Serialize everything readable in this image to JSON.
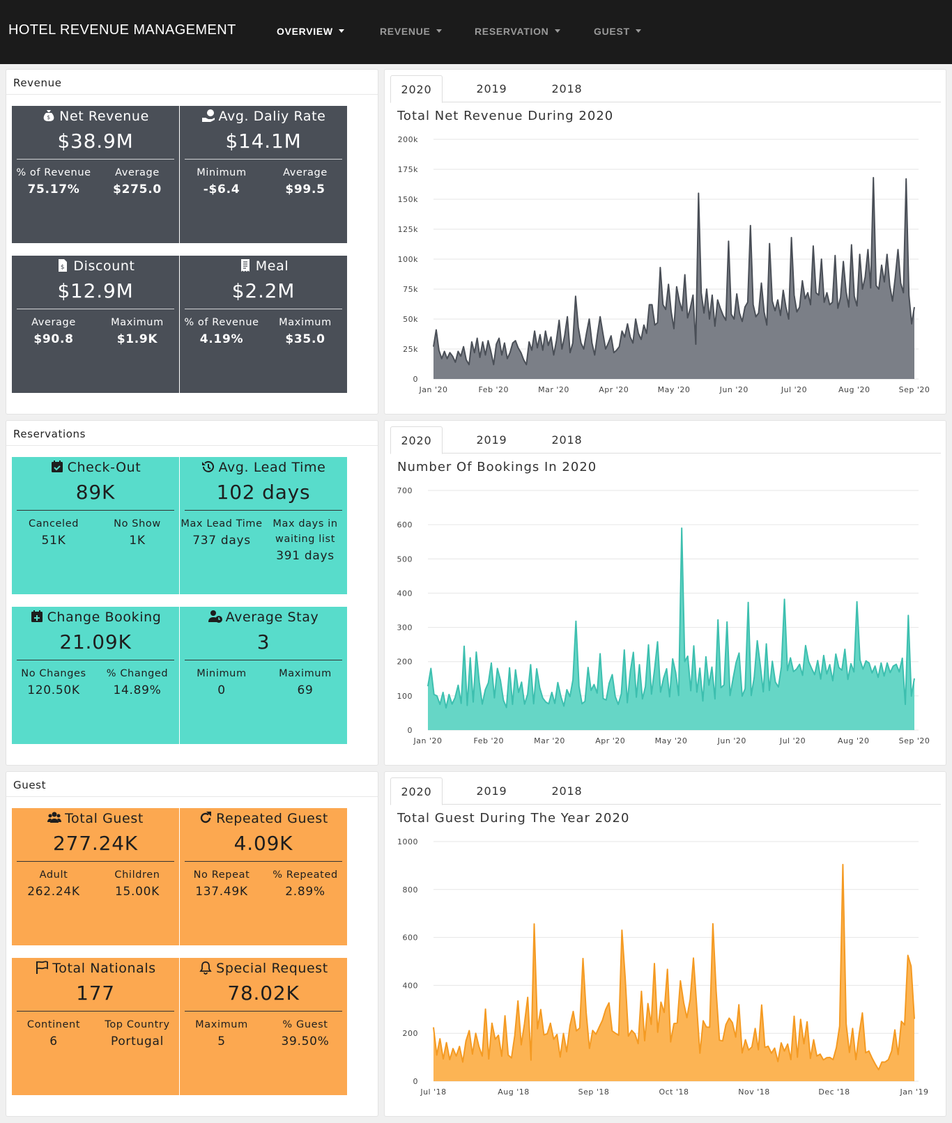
{
  "nav": {
    "brand": "HOTEL REVENUE MANAGEMENT",
    "items": [
      {
        "label": "OVERVIEW",
        "active": true
      },
      {
        "label": "REVENUE",
        "active": false
      },
      {
        "label": "RESERVATION",
        "active": false
      },
      {
        "label": "GUEST",
        "active": false
      }
    ]
  },
  "sections": {
    "revenue": {
      "title": "Revenue",
      "cards": [
        {
          "icon": "money-bag-icon",
          "title": "Net Revenue",
          "value": "$38.9M",
          "stats": [
            {
              "label": "% of Revenue",
              "value": "75.17%"
            },
            {
              "label": "Average",
              "value": "$275.0"
            }
          ]
        },
        {
          "icon": "hand-money-icon",
          "title": "Avg. Daliy Rate",
          "value": "$14.1M",
          "stats": [
            {
              "label": "Minimum",
              "value": "-$6.4"
            },
            {
              "label": "Average",
              "value": "$99.5"
            }
          ]
        },
        {
          "icon": "receipt-dollar-icon",
          "title": "Discount",
          "value": "$12.9M",
          "stats": [
            {
              "label": "Average",
              "value": "$90.8"
            },
            {
              "label": "Maximum",
              "value": "$1.9K"
            }
          ]
        },
        {
          "icon": "menu-receipt-icon",
          "title": "Meal",
          "value": "$2.2M",
          "stats": [
            {
              "label": "% of Revenue",
              "value": "4.19%"
            },
            {
              "label": "Maximum",
              "value": "$35.0"
            }
          ]
        }
      ]
    },
    "reservations": {
      "title": "Reservations",
      "cards": [
        {
          "icon": "calendar-check-icon",
          "title": "Check-Out",
          "value": "89K",
          "stats": [
            {
              "label": "Canceled",
              "value": "51K"
            },
            {
              "label": "No Show",
              "value": "1K"
            }
          ]
        },
        {
          "icon": "history-icon",
          "title": "Avg. Lead Time",
          "value": "102 days",
          "stats": [
            {
              "label": "Max Lead Time",
              "value": "737 days"
            },
            {
              "label": "Max days in waiting list",
              "value": "391 days"
            }
          ]
        },
        {
          "icon": "calendar-plus-icon",
          "title": "Change Booking",
          "value": "21.09K",
          "stats": [
            {
              "label": "No Changes",
              "value": "120.50K"
            },
            {
              "label": "% Changed",
              "value": "14.89%"
            }
          ]
        },
        {
          "icon": "user-clock-icon",
          "title": "Average Stay",
          "value": "3",
          "stats": [
            {
              "label": "Minimum",
              "value": "0"
            },
            {
              "label": "Maximum",
              "value": "69"
            }
          ]
        }
      ]
    },
    "guest": {
      "title": "Guest",
      "cards": [
        {
          "icon": "users-icon",
          "title": "Total Guest",
          "value": "277.24K",
          "stats": [
            {
              "label": "Adult",
              "value": "262.24K"
            },
            {
              "label": "Children",
              "value": "15.00K"
            }
          ]
        },
        {
          "icon": "redo-icon",
          "title": "Repeated Guest",
          "value": "4.09K",
          "stats": [
            {
              "label": "No Repeat",
              "value": "137.49K"
            },
            {
              "label": "% Repeated",
              "value": "2.89%"
            }
          ]
        },
        {
          "icon": "flag-icon",
          "title": "Total Nationals",
          "value": "177",
          "stats": [
            {
              "label": "Continent",
              "value": "6"
            },
            {
              "label": "Top Country",
              "value": "Portugal"
            }
          ]
        },
        {
          "icon": "bell-icon",
          "title": "Special Request",
          "value": "78.02K",
          "stats": [
            {
              "label": "Maximum",
              "value": "5"
            },
            {
              "label": "% Guest",
              "value": "39.50%"
            }
          ]
        }
      ]
    }
  },
  "tabs": [
    "2020",
    "2019",
    "2018"
  ],
  "colors": {
    "revenue": "#4a4f57",
    "revenue_fill": "#7b7f87",
    "bookings": "#3dbfaf",
    "bookings_fill": "#66d6c6",
    "guest": "#f49a22",
    "guest_fill": "#fcb454"
  },
  "chart_data": [
    {
      "type": "area",
      "title": "Total Net Revenue During 2020",
      "x_range": [
        "2020-01-01",
        "2020-09-05"
      ],
      "x_ticks": [
        "Jan '20",
        "Feb '20",
        "Mar '20",
        "Apr '20",
        "May '20",
        "Jun '20",
        "Jul '20",
        "Aug '20",
        "Sep '20"
      ],
      "y_ticks": [
        "0",
        "25k",
        "50k",
        "75k",
        "100k",
        "125k",
        "150k",
        "175k",
        "200k"
      ],
      "ylim": [
        0,
        200000
      ],
      "series": [
        {
          "values": [
            27000,
            41000,
            24000,
            17000,
            23000,
            17000,
            22000,
            19000,
            14000,
            23000,
            19000,
            27000,
            16000,
            12000,
            31000,
            22000,
            34000,
            18000,
            31000,
            20000,
            32000,
            23000,
            12000,
            29000,
            34000,
            20000,
            30000,
            17000,
            22000,
            30000,
            32000,
            26000,
            22000,
            16000,
            12000,
            31000,
            24000,
            40000,
            26000,
            37000,
            24000,
            40000,
            28000,
            35000,
            20000,
            32000,
            49000,
            25000,
            36000,
            52000,
            22000,
            30000,
            69000,
            43000,
            30000,
            25000,
            38000,
            50000,
            30000,
            20000,
            37000,
            52000,
            38000,
            25000,
            30000,
            36000,
            22000,
            24000,
            27000,
            40000,
            35000,
            46000,
            35000,
            30000,
            50000,
            38000,
            33000,
            45000,
            38000,
            62000,
            62000,
            45000,
            47000,
            93000,
            62000,
            58000,
            79000,
            56000,
            42000,
            77000,
            65000,
            57000,
            87000,
            51000,
            59000,
            70000,
            29000,
            155000,
            72000,
            55000,
            75000,
            50000,
            70000,
            44000,
            66000,
            59000,
            53000,
            49000,
            115000,
            54000,
            50000,
            71000,
            55000,
            48000,
            60000,
            64000,
            128000,
            62000,
            52000,
            55000,
            80000,
            56000,
            45000,
            113000,
            65000,
            57000,
            66000,
            53000,
            74000,
            60000,
            50000,
            118000,
            70000,
            56000,
            60000,
            82000,
            67000,
            72000,
            62000,
            111000,
            72000,
            70000,
            100000,
            64000,
            72000,
            62000,
            64000,
            103000,
            59000,
            68000,
            98000,
            73000,
            60000,
            112000,
            69000,
            61000,
            104000,
            75000,
            85000,
            108000,
            76000,
            168000,
            78000,
            75000,
            95000,
            81000,
            104000,
            78000,
            65000,
            85000,
            108000,
            80000,
            72000,
            167000,
            70000,
            46000,
            60000
          ]
        }
      ]
    },
    {
      "type": "area",
      "title": "Number Of Bookings In 2020",
      "x_range": [
        "2020-01-01",
        "2020-09-05"
      ],
      "x_ticks": [
        "Jan '20",
        "Feb '20",
        "Mar '20",
        "Apr '20",
        "May '20",
        "Jun '20",
        "Jul '20",
        "Aug '20",
        "Sep '20"
      ],
      "y_ticks": [
        "0",
        "100",
        "200",
        "300",
        "400",
        "500",
        "600",
        "700"
      ],
      "ylim": [
        0,
        700
      ],
      "series": [
        {
          "values": [
            128,
            180,
            104,
            100,
            75,
            110,
            65,
            104,
            76,
            95,
            131,
            78,
            245,
            72,
            211,
            82,
            228,
            140,
            76,
            118,
            138,
            196,
            94,
            180,
            146,
            87,
            66,
            182,
            75,
            176,
            110,
            140,
            76,
            105,
            191,
            77,
            179,
            124,
            94,
            82,
            77,
            110,
            78,
            139,
            98,
            70,
            118,
            98,
            147,
            318,
            128,
            77,
            84,
            183,
            116,
            133,
            108,
            223,
            92,
            88,
            137,
            162,
            98,
            75,
            106,
            234,
            80,
            172,
            227,
            96,
            191,
            91,
            127,
            249,
            105,
            177,
            258,
            111,
            152,
            179,
            97,
            208,
            168,
            101,
            590,
            200,
            216,
            115,
            246,
            111,
            181,
            85,
            214,
            131,
            184,
            91,
            322,
            124,
            132,
            316,
            101,
            151,
            197,
            225,
            99,
            121,
            373,
            101,
            154,
            261,
            190,
            112,
            252,
            116,
            201,
            140,
            126,
            185,
            382,
            174,
            211,
            171,
            178,
            192,
            160,
            247,
            200,
            180,
            162,
            203,
            149,
            218,
            164,
            191,
            144,
            222,
            183,
            175,
            236,
            148,
            194,
            170,
            375,
            205,
            178,
            202,
            196,
            167,
            187,
            154,
            196,
            158,
            196,
            168,
            187,
            192,
            170,
            210,
            75,
            335,
            99,
            151
          ]
        }
      ]
    },
    {
      "type": "area",
      "title": "Total Guest During The Year 2020",
      "x_range": [
        "2018-07-01",
        "2019-01-06"
      ],
      "x_ticks": [
        "Jul '18",
        "Aug '18",
        "Sep '18",
        "Oct '18",
        "Nov '18",
        "Dec '18",
        "Jan '19"
      ],
      "y_ticks": [
        "0",
        "200",
        "400",
        "600",
        "800",
        "1000"
      ],
      "ylim": [
        0,
        1000
      ],
      "series": [
        {
          "values": [
            225,
            109,
            177,
            93,
            161,
            90,
            136,
            105,
            145,
            80,
            168,
            211,
            113,
            200,
            144,
            105,
            301,
            93,
            242,
            175,
            192,
            104,
            273,
            109,
            97,
            190,
            335,
            152,
            239,
            350,
            88,
            656,
            219,
            299,
            193,
            198,
            242,
            175,
            195,
            101,
            199,
            123,
            231,
            291,
            210,
            222,
            512,
            286,
            137,
            212,
            196,
            226,
            254,
            299,
            327,
            210,
            200,
            192,
            630,
            430,
            188,
            212,
            197,
            157,
            375,
            169,
            324,
            237,
            491,
            204,
            330,
            287,
            467,
            164,
            240,
            243,
            419,
            328,
            265,
            341,
            514,
            316,
            117,
            252,
            226,
            225,
            657,
            376,
            171,
            168,
            236,
            263,
            244,
            184,
            319,
            118,
            173,
            130,
            143,
            220,
            131,
            318,
            141,
            146,
            117,
            138,
            82,
            160,
            126,
            155,
            90,
            271,
            100,
            258,
            156,
            248,
            95,
            173,
            105,
            113,
            89,
            98,
            99,
            90,
            140,
            230,
            904,
            240,
            120,
            220,
            90,
            195,
            285,
            119,
            126,
            96,
            70,
            48,
            80,
            80,
            90,
            126,
            214,
            111,
            250,
            235,
            525,
            480,
            260
          ]
        }
      ]
    }
  ]
}
